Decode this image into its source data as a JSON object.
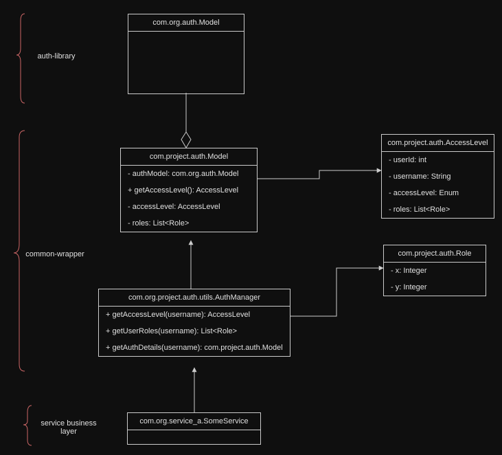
{
  "layers": {
    "auth_library": "auth-library",
    "common_wrapper": "common-wrapper",
    "service_business": "service business\nlayer"
  },
  "classes": {
    "org_model": {
      "title": "com.org.auth.Model"
    },
    "project_model": {
      "title": "com.project.auth.Model",
      "rows": [
        "- authModel: com.org.auth.Model",
        "+ getAccessLevel(): AccessLevel",
        "- accessLevel: AccessLevel",
        "- roles: List<Role>"
      ]
    },
    "access_level": {
      "title": "com.project.auth.AccessLevel",
      "rows": [
        "- userId: int",
        "- username: String",
        "- accessLevel: Enum",
        "- roles: List<Role>"
      ]
    },
    "role": {
      "title": "com.project.auth.Role",
      "rows": [
        "- x: Integer",
        "- y: Integer"
      ]
    },
    "auth_manager": {
      "title": "com.org.project.auth.utils.AuthManager",
      "rows": [
        "+ getAccessLevel(username): AccessLevel",
        "+ getUserRoles(username): List<Role>",
        "+ getAuthDetails(username): com.project.auth.Model"
      ]
    },
    "some_service": {
      "title": "com.org.service_a.SomeService"
    }
  }
}
